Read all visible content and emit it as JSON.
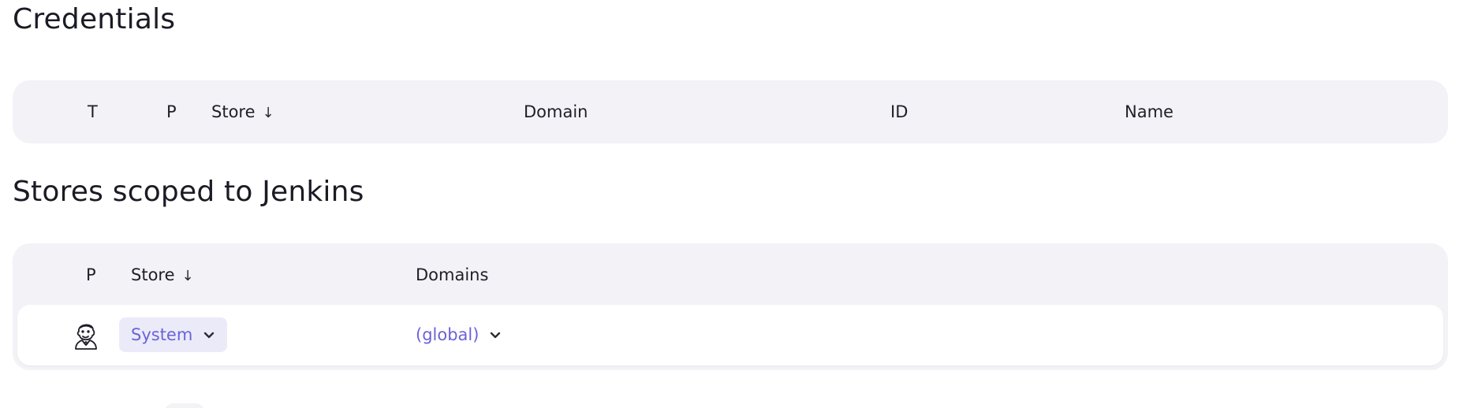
{
  "credentials": {
    "title": "Credentials",
    "columns": {
      "type": "T",
      "provider": "P",
      "store": "Store",
      "store_sort": "↓",
      "domain": "Domain",
      "id": "ID",
      "name": "Name"
    }
  },
  "stores": {
    "title": "Stores scoped to Jenkins",
    "columns": {
      "provider": "P",
      "store": "Store",
      "store_sort": "↓",
      "domains": "Domains"
    },
    "rows": [
      {
        "provider_icon": "jenkins-butler-icon",
        "store": "System",
        "domain": "(global)"
      }
    ]
  },
  "colors": {
    "header_bg": "#f2f2f7",
    "link": "#6a63d8",
    "button_bg": "#ebeaf9",
    "text": "#1f1f28"
  }
}
